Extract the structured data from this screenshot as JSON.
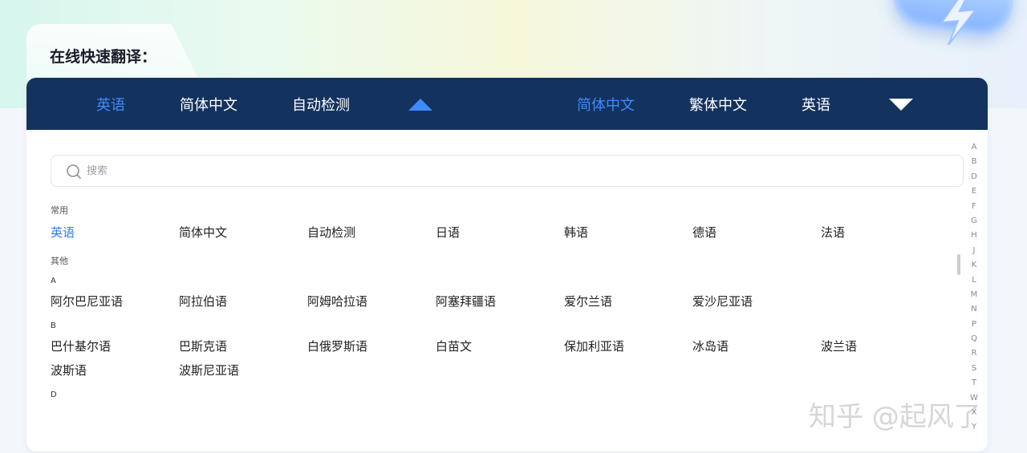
{
  "page": {
    "title": "在线快速翻译："
  },
  "source_bar": {
    "tabs": [
      {
        "label": "英语",
        "active": true
      },
      {
        "label": "简体中文",
        "active": false
      },
      {
        "label": "自动检测",
        "active": false
      }
    ]
  },
  "target_bar": {
    "tabs": [
      {
        "label": "简体中文",
        "active": true
      },
      {
        "label": "繁体中文",
        "active": false
      },
      {
        "label": "英语",
        "active": false
      }
    ]
  },
  "search": {
    "placeholder": "搜索",
    "value": ""
  },
  "common": {
    "label": "常用",
    "items": [
      "英语",
      "简体中文",
      "自动检测",
      "日语",
      "韩语",
      "德语",
      "法语"
    ]
  },
  "others": {
    "label": "其他",
    "groups": [
      {
        "letter": "A",
        "items": [
          "阿尔巴尼亚语",
          "阿拉伯语",
          "阿姆哈拉语",
          "阿塞拜疆语",
          "爱尔兰语",
          "爱沙尼亚语"
        ]
      },
      {
        "letter": "B",
        "items": [
          "巴什基尔语",
          "巴斯克语",
          "白俄罗斯语",
          "白苗文",
          "保加利亚语",
          "冰岛语",
          "波兰语",
          "波斯语",
          "波斯尼亚语"
        ]
      },
      {
        "letter": "D",
        "items": []
      }
    ]
  },
  "alphabet_index": [
    "A",
    "B",
    "D",
    "E",
    "F",
    "G",
    "H",
    "J",
    "K",
    "L",
    "M",
    "N",
    "P",
    "Q",
    "R",
    "S",
    "T",
    "W",
    "X",
    "Y"
  ],
  "watermark": "知乎 @起风了",
  "colors": {
    "bar_bg": "#13325e",
    "accent": "#3d8bff",
    "active_item": "#2f7df0"
  }
}
